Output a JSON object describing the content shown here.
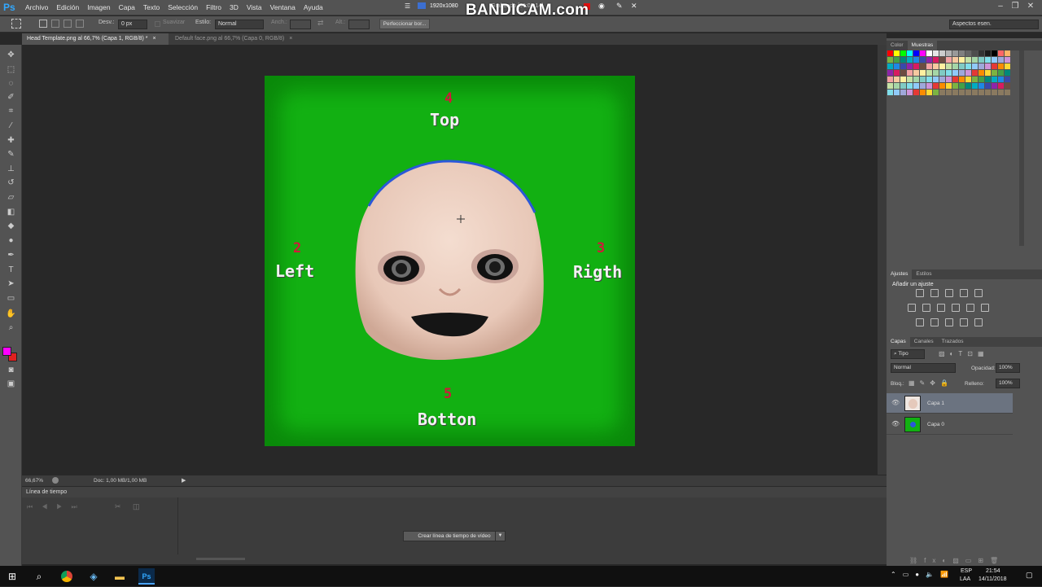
{
  "app": {
    "logo": "Ps"
  },
  "menu": [
    "Archivo",
    "Edición",
    "Imagen",
    "Capa",
    "Texto",
    "Selección",
    "Filtro",
    "3D",
    "Vista",
    "Ventana",
    "Ayuda"
  ],
  "recording": {
    "resolution": "1920x1080",
    "time": "Grabando [00:02:14]",
    "brand": "BANDICAM.com"
  },
  "options": {
    "desv_label": "Desv.:",
    "desv_value": "0 px",
    "suavizar": "Suavizar",
    "estilo_label": "Estilo:",
    "estilo_value": "Normal",
    "anch_label": "Anch.:",
    "alt_label": "Alt.:",
    "refine_button": "Perfeccionar bor...",
    "workspace": "Aspectos esen."
  },
  "tabs": [
    {
      "label": "Head Template.png al 66,7% (Capa 1, RGB/8) *",
      "close": "×"
    },
    {
      "label": "Default face.png al 66,7% (Capa 0, RGB/8)",
      "close": "×"
    }
  ],
  "canvas_labels": {
    "top_num": "4",
    "top": "Top",
    "left_num": "2",
    "left": "Left",
    "right_num": "3",
    "right": "Rigth",
    "bottom_num": "5",
    "bottom": "Botton"
  },
  "status": {
    "zoom": "66,67%",
    "doc": "Doc: 1,00 MB/1,00 MB"
  },
  "timeline": {
    "title": "Línea de tiempo",
    "create_button": "Crear línea de tiempo de vídeo"
  },
  "panels": {
    "color_tab": "Color",
    "swatches_tab": "Muestras",
    "ajustes_tab": "Ajustes",
    "estilos_tab": "Estilos",
    "add_adjust": "Añadir un ajuste",
    "capas_tab": "Capas",
    "canales_tab": "Canales",
    "trazados_tab": "Trazados",
    "kind": "Tipo",
    "blend": "Normal",
    "opacity_label": "Opacidad:",
    "opacity_value": "100%",
    "lock_label": "Bloq.:",
    "fill_label": "Relleno:",
    "fill_value": "100%"
  },
  "layers": [
    {
      "name": "Capa 1",
      "selected": true
    },
    {
      "name": "Capa 0",
      "selected": false
    }
  ],
  "colors": {
    "foreground": "#ff00ff",
    "background": "#e02020",
    "canvas_green": "#12b012"
  },
  "taskbar": {
    "lang_top": "ESP",
    "lang_bottom": "LAA",
    "time": "21:54",
    "date": "14/11/2018"
  }
}
